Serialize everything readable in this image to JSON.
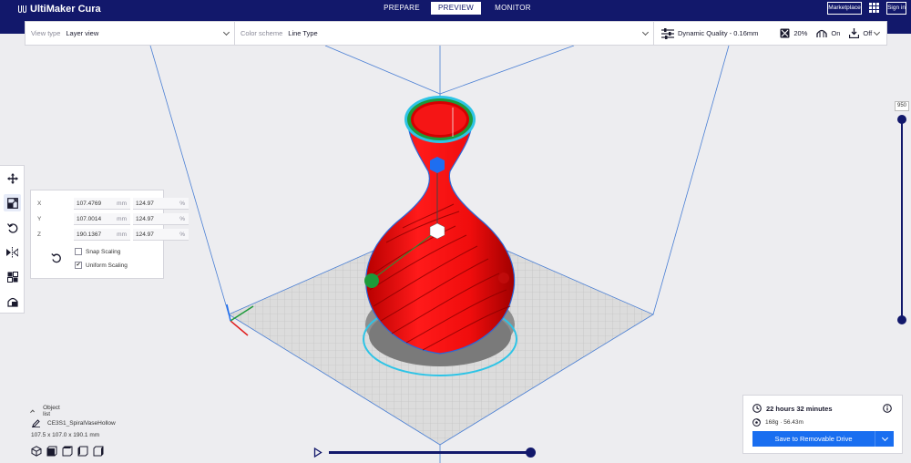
{
  "header": {
    "brand": "UltiMaker Cura",
    "stages": [
      {
        "label": "PREPARE",
        "active": false
      },
      {
        "label": "PREVIEW",
        "active": true
      },
      {
        "label": "MONITOR",
        "active": false
      }
    ],
    "marketplace_label": "Marketplace",
    "signin_label": "Sign in"
  },
  "toolbar": {
    "view_type_label": "View type",
    "view_type_value": "Layer view",
    "color_scheme_label": "Color scheme",
    "color_scheme_value": "Line Type",
    "quality": "Dynamic Quality - 0.16mm",
    "infill": "20%",
    "support": "On",
    "adhesion": "Off"
  },
  "tools": [
    {
      "name": "move-tool-button",
      "icon": "move-icon"
    },
    {
      "name": "scale-tool-button",
      "icon": "scale-icon",
      "active": true
    },
    {
      "name": "rotate-tool-button",
      "icon": "rotate-icon"
    },
    {
      "name": "mirror-tool-button",
      "icon": "mirror-icon"
    },
    {
      "name": "per-model-settings-button",
      "icon": "per-model-settings-icon"
    },
    {
      "name": "support-blocker-button",
      "icon": "support-blocker-icon"
    }
  ],
  "scale_panel": {
    "rows": [
      {
        "axis": "X",
        "mm": "107.4769",
        "mm_unit": "mm",
        "pct": "124.97",
        "pct_unit": "%"
      },
      {
        "axis": "Y",
        "mm": "107.0014",
        "mm_unit": "mm",
        "pct": "124.97",
        "pct_unit": "%"
      },
      {
        "axis": "Z",
        "mm": "190.1367",
        "mm_unit": "mm",
        "pct": "124.97",
        "pct_unit": "%"
      }
    ],
    "snap_scaling_label": "Snap Scaling",
    "snap_scaling_checked": false,
    "uniform_scaling_label": "Uniform Scaling",
    "uniform_scaling_checked": true
  },
  "layer_slider": {
    "current_layer": "950",
    "upper_fraction": 1.0,
    "lower_fraction": 0.0
  },
  "object_list": {
    "title": "Object list",
    "object_name": "CE3S1_SpiralVaseHollow",
    "dimensions": "107.5 x 107.0 x 190.1 mm"
  },
  "simulation": {
    "progress": 1.0
  },
  "print_info": {
    "time": "22 hours 32 minutes",
    "material": "168g · 56.43m",
    "save_label": "Save to Removable Drive"
  },
  "colors": {
    "header_bg": "#12186b",
    "accent_blue": "#196ef0",
    "vase_red": "#f01010",
    "skirt_cyan": "#2ec4e6",
    "grid_line": "#4a7fd4"
  }
}
